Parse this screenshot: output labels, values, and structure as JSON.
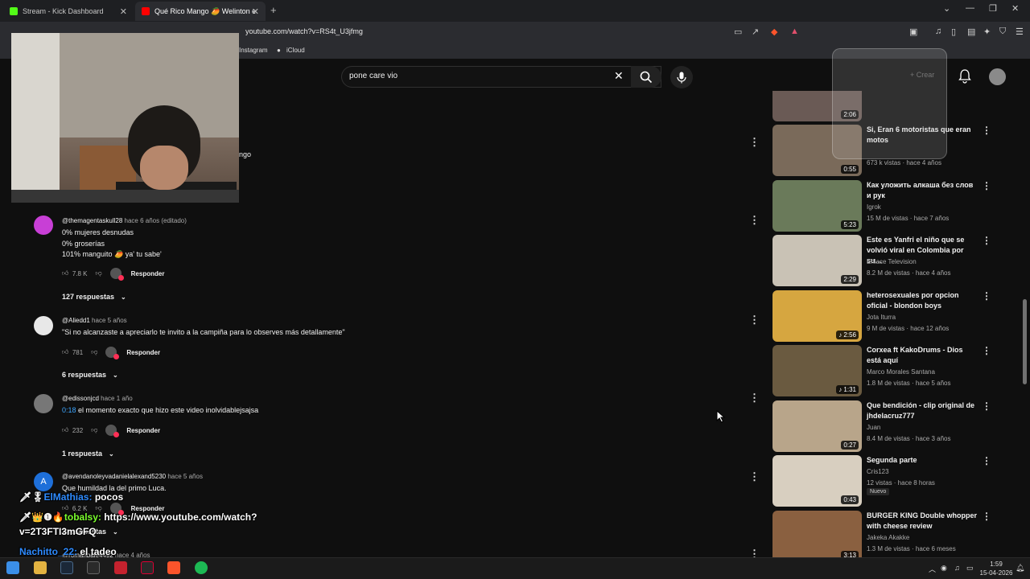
{
  "browser": {
    "tabs": [
      {
        "label": "Stream - Kick Dashboard",
        "favicon_color": "#53fc18"
      },
      {
        "label": "Qué Rico Mango 🥭 Welinton e",
        "favicon_color": "#ff0000"
      }
    ],
    "url": "youtube.com/watch?v=RS4t_U3jfmg",
    "bookmarks": [
      "Instagram",
      "iCloud"
    ]
  },
  "header": {
    "search_value": "pone care vio",
    "create_label": "+ Crear"
  },
  "behind_webcam_text": "ngo",
  "comments": [
    {
      "handle": "@themagentaskull28",
      "time": "hace 6 años (editado)",
      "lines": [
        "0% mujeres desnudas",
        "0% groserías",
        "101% manguito 🥭 ya' tu sabe'"
      ],
      "likes": "7.8 K",
      "reply_label": "Responder",
      "replies": "127 respuestas",
      "avatar_color": "#c83fd6"
    },
    {
      "handle": "@Aliedd1",
      "time": "hace 5 años",
      "lines": [
        "\"Si no alcanzaste a apreciarlo te invito a la campiña para lo observes más detallamente\""
      ],
      "likes": "781",
      "reply_label": "Responder",
      "replies": "6 respuestas",
      "avatar_color": "#e8e8e8"
    },
    {
      "handle": "@edissonjcd",
      "time": "hace 1 año",
      "timestamp_link": "0:18",
      "lines": [
        " el momento exacto que hizo este video inolvidablejsajsa"
      ],
      "likes": "232",
      "reply_label": "Responder",
      "replies": "1 respuesta",
      "avatar_color": "#777777"
    },
    {
      "handle": "@avendanoleyvadanielalexand5230",
      "time": "hace 5 años",
      "lines": [
        "Que humildad la del primo Luca."
      ],
      "likes": "6.2 K",
      "reply_label": "Responder",
      "replies": "2 respuestas",
      "avatar_letter": "A",
      "avatar_color": "#1e6fd9"
    },
    {
      "handle": "@romanbale4492",
      "time": "hace 4 años"
    }
  ],
  "chat": [
    {
      "user": "ElMathias:",
      "message": " pocos",
      "color": "#2e8bff",
      "prefix": "🗡🎖"
    },
    {
      "user": "tobalsy:",
      "message": " https://www.youtube.com/watch?",
      "color": "#7cff2e",
      "prefix": "🗡👑❶🔥"
    },
    {
      "user": "",
      "message": "v=2T3FTI3mGFQ",
      "color": "#ffffff",
      "prefix": ""
    },
    {
      "user": "Nachitto_22:",
      "message": " el tadeo",
      "color": "#2e8bff",
      "prefix": ""
    }
  ],
  "sidebar": [
    {
      "title": "Si, Eran 6 motoristas que eran motos",
      "channel": "",
      "meta": "673 k vistas · hace 4 años",
      "duration": "0:55",
      "thumb": "#7a6a5a"
    },
    {
      "title": "Как уложить алкаша без слов и рук",
      "channel": "Igrok",
      "meta": "15 M de vistas · hace 7 años",
      "duration": "5:23",
      "thumb": "#6a7a5a"
    },
    {
      "title": "Este es Yanfri el niño que se volvió viral en Colombia por su…",
      "channel": "Enlace Television",
      "meta": "8.2 M de vistas · hace 4 años",
      "duration": "2:29",
      "thumb": "#c9c2b5"
    },
    {
      "title": "heterosexuales por opcion oficial - blondon boys",
      "channel": "Jota Iturra",
      "meta": "9 M de vistas · hace 12 años",
      "duration": "♪ 2:56",
      "thumb": "#d6a640"
    },
    {
      "title": "Corxea ft KakoDrums - Dios está aquí",
      "channel": "Marco Morales Santana",
      "meta": "1.8 M de vistas · hace 5 años",
      "duration": "♪ 1:31",
      "thumb": "#6a5a40"
    },
    {
      "title": "Que bendición - clip original de jhdelacruz777",
      "channel": "Juan",
      "meta": "8.4 M de vistas · hace 3 años",
      "duration": "0:27",
      "thumb": "#b8a58a"
    },
    {
      "title": "Segunda parte",
      "channel": "Cris123",
      "meta": "12 vistas · hace 8 horas",
      "duration": "0:43",
      "thumb": "#d8cfc0",
      "badge": "Nuevo"
    },
    {
      "title": "BURGER KING Double whopper with cheese review",
      "channel": "Jakeka Akakke",
      "meta": "1.3 M de vistas · hace 6 meses",
      "duration": "3:13",
      "thumb": "#8a6040"
    }
  ],
  "partial_top": {
    "duration": "2:06"
  },
  "taskbar": {
    "time": "1:59",
    "date": "15-04-2026"
  }
}
